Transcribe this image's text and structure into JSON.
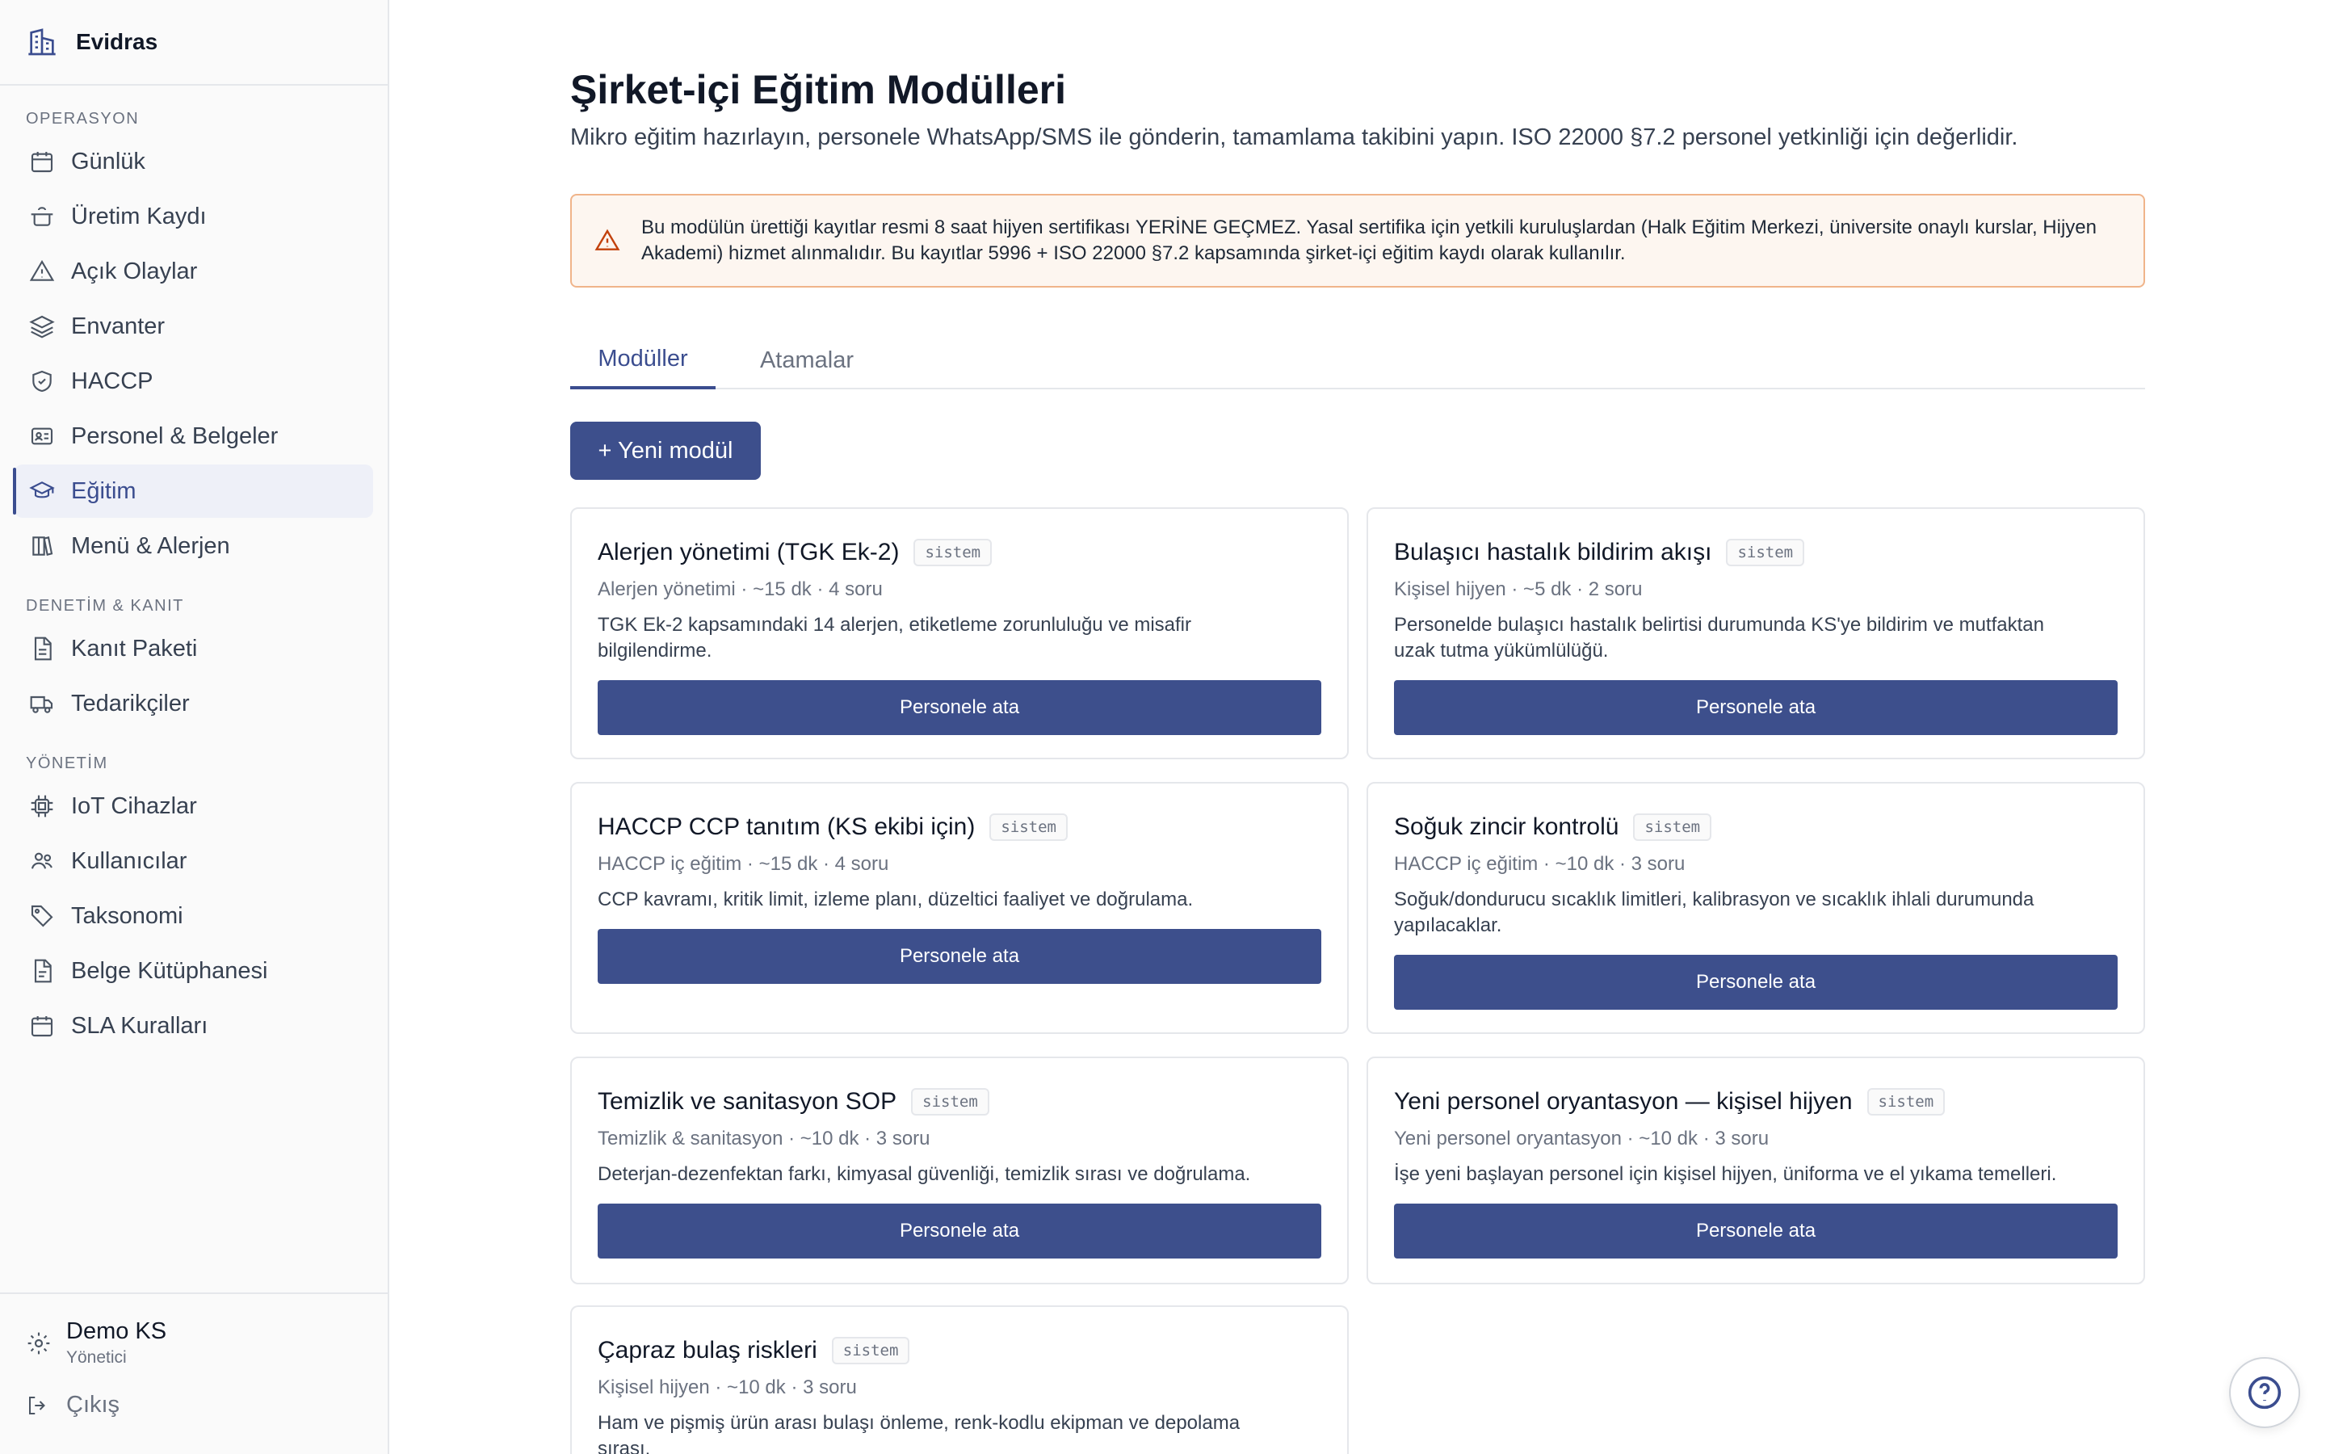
{
  "app": {
    "name": "Evidras"
  },
  "sidebar": {
    "sections": [
      {
        "label": "OPERASYON",
        "items": [
          {
            "label": "Günlük",
            "icon": "calendar-icon"
          },
          {
            "label": "Üretim Kaydı",
            "icon": "cooking-pot-icon"
          },
          {
            "label": "Açık Olaylar",
            "icon": "warning-triangle-icon"
          },
          {
            "label": "Envanter",
            "icon": "layers-icon"
          },
          {
            "label": "HACCP",
            "icon": "shield-check-icon"
          },
          {
            "label": "Personel & Belgeler",
            "icon": "id-card-icon"
          },
          {
            "label": "Eğitim",
            "icon": "graduation-cap-icon",
            "active": true
          },
          {
            "label": "Menü & Alerjen",
            "icon": "book-icon"
          }
        ]
      },
      {
        "label": "DENETİM & KANIT",
        "items": [
          {
            "label": "Kanıt Paketi",
            "icon": "file-text-icon"
          },
          {
            "label": "Tedarikçiler",
            "icon": "truck-icon"
          }
        ]
      },
      {
        "label": "YÖNETİM",
        "items": [
          {
            "label": "IoT Cihazlar",
            "icon": "cpu-icon"
          },
          {
            "label": "Kullanıcılar",
            "icon": "users-icon"
          },
          {
            "label": "Taksonomi",
            "icon": "tag-icon"
          },
          {
            "label": "Belge Kütüphanesi",
            "icon": "file-icon"
          },
          {
            "label": "SLA Kuralları",
            "icon": "calendar-icon"
          }
        ]
      }
    ],
    "user": {
      "name": "Demo KS",
      "role": "Yönetici"
    },
    "logout": "Çıkış"
  },
  "page": {
    "title": "Şirket-içi Eğitim Modülleri",
    "subtitle": "Mikro eğitim hazırlayın, personele WhatsApp/SMS ile gönderin, tamamlama takibini yapın. ISO 22000 §7.2 personel yetkinliği için değerlidir.",
    "warning": "Bu modülün ürettiği kayıtlar resmi 8 saat hijyen sertifikası YERİNE GEÇMEZ. Yasal sertifika için yetkili kuruluşlardan (Halk Eğitim Merkezi, üniversite onaylı kurslar, Hijyen Akademi) hizmet alınmalıdır. Bu kayıtlar 5996 + ISO 22000 §7.2 kapsamında şirket-içi eğitim kaydı olarak kullanılır.",
    "tabs": {
      "modules": "Modüller",
      "assignments": "Atamalar"
    },
    "new_module_label": "+ Yeni modül",
    "assign_label": "Personele ata",
    "badge_label": "sistem",
    "modules": [
      {
        "title": "Alerjen yönetimi (TGK Ek-2)",
        "meta": "Alerjen yönetimi · ~15 dk · 4 soru",
        "desc": "TGK Ek-2 kapsamındaki 14 alerjen, etiketleme zorunluluğu ve misafir bilgilendirme."
      },
      {
        "title": "Bulaşıcı hastalık bildirim akışı",
        "meta": "Kişisel hijyen · ~5 dk · 2 soru",
        "desc": "Personelde bulaşıcı hastalık belirtisi durumunda KS'ye bildirim ve mutfaktan uzak tutma yükümlülüğü."
      },
      {
        "title": "HACCP CCP tanıtım (KS ekibi için)",
        "meta": "HACCP iç eğitim · ~15 dk · 4 soru",
        "desc": "CCP kavramı, kritik limit, izleme planı, düzeltici faaliyet ve doğrulama."
      },
      {
        "title": "Soğuk zincir kontrolü",
        "meta": "HACCP iç eğitim · ~10 dk · 3 soru",
        "desc": "Soğuk/dondurucu sıcaklık limitleri, kalibrasyon ve sıcaklık ihlali durumunda yapılacaklar."
      },
      {
        "title": "Temizlik ve sanitasyon SOP",
        "meta": "Temizlik & sanitasyon · ~10 dk · 3 soru",
        "desc": "Deterjan-dezenfektan farkı, kimyasal güvenliği, temizlik sırası ve doğrulama."
      },
      {
        "title": "Yeni personel oryantasyon — kişisel hijyen",
        "meta": "Yeni personel oryantasyon · ~10 dk · 3 soru",
        "desc": "İşe yeni başlayan personel için kişisel hijyen, üniforma ve el yıkama temelleri."
      },
      {
        "title": "Çapraz bulaş riskleri",
        "meta": "Kişisel hijyen · ~10 dk · 3 soru",
        "desc": "Ham ve pişmiş ürün arası bulaşı önleme, renk-kodlu ekipman ve depolama sırası."
      }
    ]
  },
  "colors": {
    "primary": "#3d4f8c",
    "warning_bg": "#fdf6f0",
    "warning_border": "#f0b48a"
  }
}
